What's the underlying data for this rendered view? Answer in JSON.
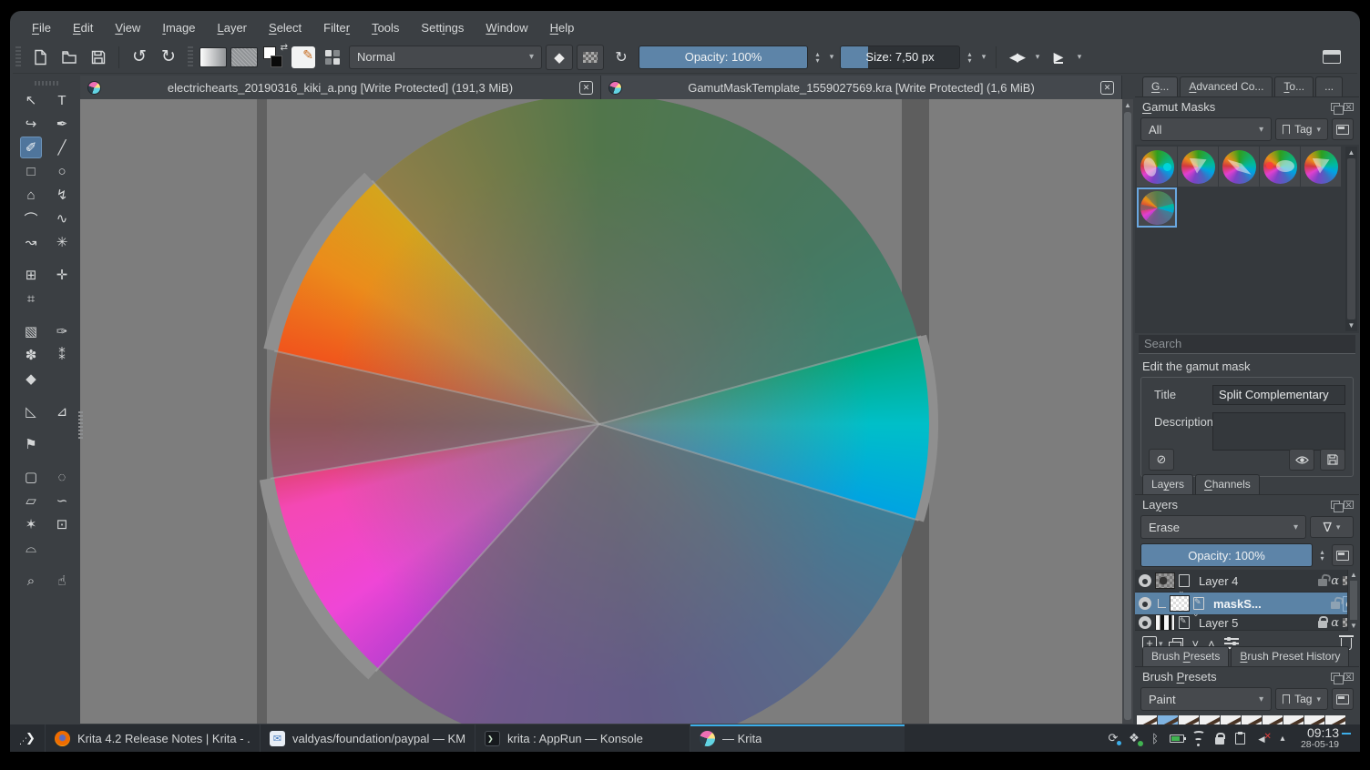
{
  "menu": {
    "items": [
      {
        "label": "File",
        "u": 0
      },
      {
        "label": "Edit",
        "u": 0
      },
      {
        "label": "View",
        "u": 0
      },
      {
        "label": "Image",
        "u": 0
      },
      {
        "label": "Layer",
        "u": 0
      },
      {
        "label": "Select",
        "u": 0
      },
      {
        "label": "Filter",
        "u": 5
      },
      {
        "label": "Tools",
        "u": 0
      },
      {
        "label": "Settings",
        "u": 4
      },
      {
        "label": "Window",
        "u": 0
      },
      {
        "label": "Help",
        "u": 0
      }
    ]
  },
  "toolbar": {
    "blend_mode": "Normal",
    "opacity_label": "Opacity:  100%",
    "size_label": "Size:  7,50 px"
  },
  "doc_tabs": [
    {
      "label": "electrichearts_20190316_kiki_a.png [Write Protected]  (191,3 MiB)",
      "active": false
    },
    {
      "label": "GamutMaskTemplate_1559027569.kra [Write Protected]  (1,6 MiB)",
      "active": true
    }
  ],
  "toolbox": {
    "tools": [
      {
        "name": "select-shapes-tool",
        "glyph": "↖"
      },
      {
        "name": "text-tool",
        "glyph": "T"
      },
      {
        "name": "edit-shapes-tool",
        "glyph": "↪"
      },
      {
        "name": "calligraphy-tool",
        "glyph": "✒"
      },
      {
        "name": "freehand-brush-tool",
        "glyph": "✐",
        "selected": true
      },
      {
        "name": "line-tool",
        "glyph": "╱"
      },
      {
        "name": "rectangle-tool",
        "glyph": "□"
      },
      {
        "name": "ellipse-tool",
        "glyph": "○"
      },
      {
        "name": "polygon-tool",
        "glyph": "⌂"
      },
      {
        "name": "polyline-tool",
        "glyph": "↯"
      },
      {
        "name": "bezier-curve-tool",
        "glyph": "⌒"
      },
      {
        "name": "freehand-path-tool",
        "glyph": "∿"
      },
      {
        "name": "dynamic-brush-tool",
        "glyph": "↝"
      },
      {
        "name": "multibrush-tool",
        "glyph": "✳"
      },
      {
        "name": "transform-tool",
        "glyph": "⊞",
        "gap": true
      },
      {
        "name": "move-tool",
        "glyph": "✛"
      },
      {
        "name": "crop-tool",
        "glyph": "⌗"
      },
      {
        "name": "spacer",
        "glyph": ""
      },
      {
        "name": "gradient-tool",
        "glyph": "▧",
        "gap": true
      },
      {
        "name": "color-sampler-tool",
        "glyph": "✑"
      },
      {
        "name": "colorize-mask-tool",
        "glyph": "✽"
      },
      {
        "name": "smart-patch-tool",
        "glyph": "⁑"
      },
      {
        "name": "fill-tool",
        "glyph": "◆"
      },
      {
        "name": "spacer",
        "glyph": ""
      },
      {
        "name": "measure-tool",
        "glyph": "◺",
        "gap": true
      },
      {
        "name": "assistants-tool",
        "glyph": "⊿"
      },
      {
        "name": "reference-images-tool",
        "glyph": "⚑",
        "gap": true
      },
      {
        "name": "spacer",
        "glyph": ""
      },
      {
        "name": "rect-select-tool",
        "glyph": "▢",
        "gap": true
      },
      {
        "name": "ellipse-select-tool",
        "glyph": "◌"
      },
      {
        "name": "polygon-select-tool",
        "glyph": "▱"
      },
      {
        "name": "freehand-select-tool",
        "glyph": "∽"
      },
      {
        "name": "magic-wand-select-tool",
        "glyph": "✶"
      },
      {
        "name": "similar-select-tool",
        "glyph": "⊡"
      },
      {
        "name": "bezier-select-tool",
        "glyph": "⌓"
      },
      {
        "name": "spacer",
        "glyph": ""
      },
      {
        "name": "zoom-tool",
        "glyph": "⌕",
        "gap": true
      },
      {
        "name": "pan-tool",
        "glyph": "☝"
      }
    ]
  },
  "right_panel": {
    "docker_tabs": [
      {
        "label": "G...",
        "u": 0,
        "active": true
      },
      {
        "label": "Advanced Co...",
        "u": 0,
        "active": false
      },
      {
        "label": "To...",
        "u": 0,
        "active": false
      },
      {
        "label": "...",
        "active": false
      }
    ],
    "gamut": {
      "title": "Gamut Masks",
      "filter_value": "All",
      "tag_label": "Tag",
      "tag_u": 2,
      "search_placeholder": "Search",
      "edit_label": "Edit the gamut mask",
      "title_label": "Title",
      "title_value": "Split Complementary",
      "description_label": "Description",
      "masks": [
        {
          "name": "mask-blob-dot",
          "shape": "blob-dot",
          "selected": false
        },
        {
          "name": "mask-triangle",
          "shape": "triangle",
          "selected": false
        },
        {
          "name": "mask-lens",
          "shape": "lens",
          "selected": false
        },
        {
          "name": "mask-dot-ellipse",
          "shape": "dot-ellipse",
          "selected": false
        },
        {
          "name": "mask-triangle-2",
          "shape": "triangle",
          "selected": false
        },
        {
          "name": "mask-split-complementary",
          "shape": "wedges",
          "selected": true
        }
      ]
    },
    "layers": {
      "tabs": [
        {
          "label": "Layers",
          "u": 2,
          "active": true
        },
        {
          "label": "Channels",
          "u": 0,
          "active": false
        }
      ],
      "title": "Layers",
      "title_u": 2,
      "blend_mode": "Erase",
      "opacity_label": "Opacity:  100%",
      "rows": [
        {
          "name": "Layer 4",
          "thumb": "dark",
          "badge": "paint",
          "selected": false,
          "indent": false,
          "lock": "open",
          "alpha": true,
          "inherit": true
        },
        {
          "name": "maskS...",
          "thumb": "light",
          "badge": "vector",
          "selected": true,
          "indent": true,
          "lock": "open",
          "alpha": true,
          "inherit": false
        },
        {
          "name": "Layer 5",
          "thumb": "bars",
          "badge": "vector",
          "selected": false,
          "indent": false,
          "lock": "closed",
          "alpha": true,
          "inherit": true
        }
      ]
    },
    "brush": {
      "tabs": [
        {
          "label": "Brush Presets",
          "u": 6,
          "active": true
        },
        {
          "label": "Brush Preset History",
          "u": 0,
          "active": false
        }
      ],
      "title": "Brush Presets",
      "title_u": 6,
      "filter_value": "Paint",
      "tag_label": "Tag",
      "tag_u": 2,
      "preset_count": 10,
      "selected_index": 1
    }
  },
  "taskbar": {
    "tasks": [
      {
        "icon": "firefox",
        "label": "Krita 4.2 Release Notes | Krita - ...",
        "active": false
      },
      {
        "icon": "kmail",
        "label": "valdyas/foundation/paypal — KM...",
        "active": false
      },
      {
        "icon": "konsole",
        "label": "krita : AppRun — Konsole",
        "active": false
      },
      {
        "icon": "krita",
        "label": "— Krita",
        "active": true
      }
    ],
    "tray_icons": [
      "update",
      "dropbox",
      "bluetooth",
      "battery",
      "wifi",
      "lock",
      "clipboard",
      "volume-muted",
      "expand"
    ],
    "clock_time": "09:13",
    "clock_date": "28-05-19"
  }
}
